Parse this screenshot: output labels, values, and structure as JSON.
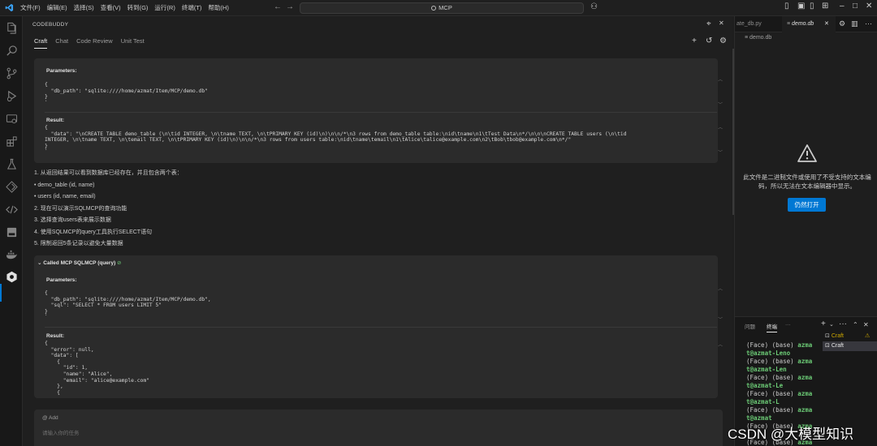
{
  "titlebar": {
    "menus": [
      "文件(F)",
      "编辑(E)",
      "选择(S)",
      "查看(V)",
      "转到(G)",
      "运行(R)",
      "终端(T)",
      "帮助(H)"
    ],
    "search": "MCP"
  },
  "panel": {
    "title": "CODEBUDDY",
    "tabs": [
      "Craft",
      "Chat",
      "Code Review",
      "Unit Test"
    ],
    "card1": {
      "params_label": "Parameters:",
      "params_code": "{\n  \"db_path\": \"sqlite:////home/azmat/Item/MCP/demo.db\"\n}\n`",
      "result_label": "Result:",
      "result_code": "{\n  \"data\": \"\\nCREATE TABLE demo_table (\\n\\tid INTEGER, \\n\\tname TEXT, \\n\\tPRIMARY KEY (id)\\n)\\n\\n/*\\n3 rows from demo_table table:\\nid\\tname\\n1\\tTest Data\\n*/\\n\\n\\nCREATE TABLE users (\\n\\tid\nINTEGER, \\n\\tname TEXT, \\n\\temail TEXT, \\n\\tPRIMARY KEY (id)\\n)\\n\\n/*\\n3 rows from users table:\\nid\\tname\\temail\\n1\\tAlice\\talice@example.com\\n2\\tBob\\tbob@example.com\\n*/\"\n}\n`"
    },
    "list": [
      "1. 从返回结果可以看到数据库已经存在，并且包含两个表：",
      "•   demo_table (id, name)",
      "•   users (id, name, email)",
      "2. 现在可以演示SQLMCP的查询功能",
      "3. 选择查询users表来展示数据",
      "4. 使用SQLMCP的query工具执行SELECT语句",
      "5. 限制返回5条记录以避免大量数据"
    ],
    "card2": {
      "header": "Called MCP SQLMCP (query)",
      "params_label": "Parameters:",
      "params_code": "{\n  \"db_path\": \"sqlite:////home/azmat/Item/MCP/demo.db\",\n  \"sql\": \"SELECT * FROM users LIMIT 5\"\n}\n`",
      "result_label": "Result:",
      "result_code": "{\n  \"error\": null,\n  \"data\": [\n    {\n      \"id\": 1,\n      \"name\": \"Alice\",\n      \"email\": \"alice@example.com\"\n    },\n    {"
    },
    "chat": {
      "add_label": "@ Add",
      "placeholder": "请输入你的任务"
    }
  },
  "editor": {
    "tab_prev": "ate_db.py",
    "tab_active": "demo.db",
    "breadcrumb": "demo.db",
    "message": "此文件是二进制文件或使用了不受支持的文本编码，所以无法在文本编辑器中显示。",
    "open_button": "仍然打开"
  },
  "terminal": {
    "tabs": [
      "问题",
      "终端",
      "···"
    ],
    "instances": [
      "Craft",
      "Craft"
    ],
    "lines": [
      {
        "pre": "(Face) (base) ",
        "host": "azma"
      },
      {
        "pre": "",
        "host": "t@azmat-Leno"
      },
      {
        "pre": "(Face) (base) ",
        "host": "azma"
      },
      {
        "pre": "",
        "host": "t@azmat-Len"
      },
      {
        "pre": "(Face) (base) ",
        "host": "azma"
      },
      {
        "pre": "",
        "host": "t@azmat-Le"
      },
      {
        "pre": "(Face) (base) ",
        "host": "azma"
      },
      {
        "pre": "",
        "host": "t@azmat-L"
      },
      {
        "pre": "(Face) (base) ",
        "host": "azma"
      },
      {
        "pre": "",
        "host": "t@azmat"
      },
      {
        "pre": "(Face) (base) ",
        "host": "azma"
      },
      {
        "pre": "",
        "host": ""
      },
      {
        "pre": "(Face) (base) ",
        "host": "azma"
      }
    ]
  },
  "watermark": "CSDN @大模型知识",
  "colors": {
    "accent": "#0078d4",
    "warning": "#cca700",
    "success": "#6ccb76"
  }
}
